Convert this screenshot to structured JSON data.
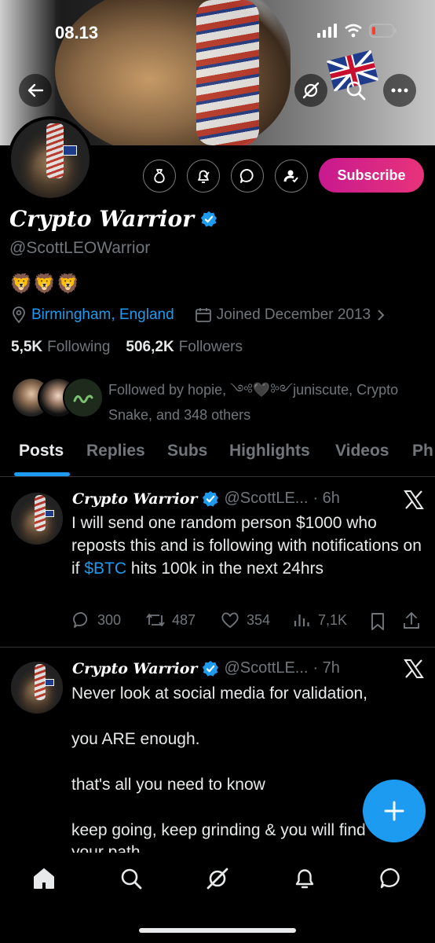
{
  "status_bar": {
    "time": "08.13"
  },
  "profile": {
    "display_name": "Crypto Warrior",
    "handle": "@ScottLEOWarrior",
    "bio": "🦁🦁🦁",
    "location": "Birmingham, England",
    "joined": "Joined December 2013",
    "following_count": "5,5K",
    "following_label": "Following",
    "followers_count": "506,2K",
    "followers_label": "Followers",
    "followed_by": "Followed by hopie, ༺🖤༻juniscute, Crypto Snake, and 348 others",
    "subscribe_label": "Subscribe"
  },
  "tabs": [
    {
      "label": "Posts"
    },
    {
      "label": "Replies"
    },
    {
      "label": "Subs"
    },
    {
      "label": "Highlights"
    },
    {
      "label": "Videos"
    },
    {
      "label": "Ph"
    }
  ],
  "posts": [
    {
      "author": "Crypto Warrior",
      "handle": "@ScottLE...",
      "time": "· 6h",
      "text_before": "I will send one random person $1000 who reposts this and is following with notifications on if ",
      "cashtag": "$BTC",
      "text_after": " hits 100k in the next 24hrs",
      "replies": "300",
      "reposts": "487",
      "likes": "354",
      "views": "7,1K"
    },
    {
      "author": "Crypto Warrior",
      "handle": "@ScottLE...",
      "time": "· 7h",
      "lines": [
        "Never look at social media for validation,",
        "you ARE enough.",
        "that's all you need to know",
        "keep going, keep grinding & you will find",
        "your path"
      ]
    }
  ],
  "colors": {
    "accent": "#1d9bf0",
    "subscribe_gradient_start": "#c8198f",
    "subscribe_gradient_end": "#e8337a",
    "muted_text": "#71767b",
    "background": "#000000"
  },
  "icons": {
    "header": [
      "back-arrow-icon",
      "grok-icon",
      "search-icon",
      "more-icon"
    ],
    "actions": [
      "money-bag-icon",
      "notify-bell-icon",
      "message-icon",
      "follow-person-icon"
    ],
    "nav": [
      "home-icon",
      "search-icon",
      "grok-icon",
      "notifications-icon",
      "messages-icon"
    ]
  }
}
